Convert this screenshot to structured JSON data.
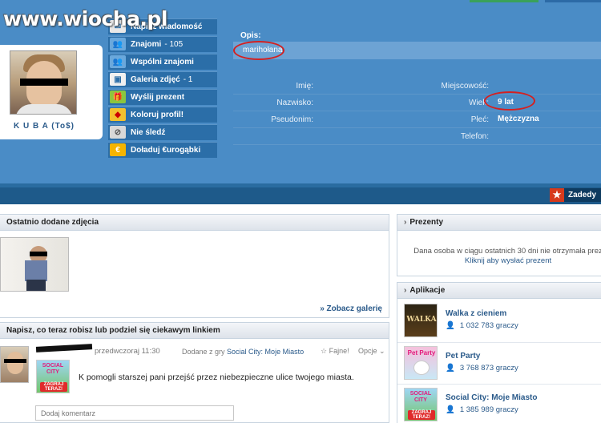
{
  "watermark": "www.wiocha.pl",
  "profile": {
    "name": "K U B A (To$)"
  },
  "menu": [
    {
      "label": "Napisz wiadomość",
      "count": "",
      "icon": "envelope-icon",
      "color": "#e8e8e8"
    },
    {
      "label": "Znajomi",
      "count": "- 105",
      "icon": "friends-icon",
      "color": "#6aa8dc"
    },
    {
      "label": "Wspólni znajomi",
      "count": "",
      "icon": "mutual-friends-icon",
      "color": "#6aa8dc"
    },
    {
      "label": "Galeria zdjęć",
      "count": "- 1",
      "icon": "gallery-icon",
      "color": "#f0f0f0"
    },
    {
      "label": "Wyślij prezent",
      "count": "",
      "icon": "gift-icon",
      "color": "#8bc53f"
    },
    {
      "label": "Koloruj profil!",
      "count": "",
      "icon": "palette-icon",
      "color": "#f2c12e"
    },
    {
      "label": "Nie śledź",
      "count": "",
      "icon": "unfollow-icon",
      "color": "#d8d8d8"
    },
    {
      "label": "Doładuj €urogąbki",
      "count": "",
      "icon": "euro-icon",
      "color": "#f5b400"
    }
  ],
  "info": {
    "opis_label": "Opis:",
    "opis_value": "marihołana",
    "rows": [
      {
        "left_label": "Imię:",
        "right_label": "Miejscowość:",
        "right_value": ""
      },
      {
        "left_label": "Nazwisko:",
        "right_label": "Wiek:",
        "right_value": "9 lat"
      },
      {
        "left_label": "Pseudonim:",
        "right_label": "Płeć:",
        "right_value": "Mężczyzna"
      },
      {
        "left_label": "",
        "right_label": "Telefon:",
        "right_value": ""
      }
    ]
  },
  "zadedy": "Zadedy",
  "photos": {
    "title": "Ostatnio dodane zdjęcia",
    "see_gallery": "» Zobacz galerię"
  },
  "status": {
    "title": "Napisz, co teraz robisz lub podziel się ciekawym linkiem",
    "time": "przedwczoraj 11:30",
    "game_prefix": "Dodane z gry",
    "game_name": "Social City: Moje Miasto",
    "like": "Fajne!",
    "options": "Opcje",
    "game_img_title": "SOCIAL CITY",
    "game_img_btn": "ZAGRAJ TERAZ!",
    "text": "K pomogli starszej pani przejść przez niebezpieczne ulice twojego miasta.",
    "comment_placeholder": "Dodaj komentarz"
  },
  "gifts": {
    "title": "Prezenty",
    "text": "Dana osoba w ciągu ostatnich 30 dni nie otrzymała prez",
    "link": "Kliknij aby wysłać prezent"
  },
  "apps": {
    "title": "Aplikacje",
    "items": [
      {
        "name": "Walka z cieniem",
        "users": "1 032 783 graczy",
        "logo_text": "WALKA"
      },
      {
        "name": "Pet Party",
        "users": "3 768 873 graczy",
        "logo_text": "Pet Party"
      },
      {
        "name": "Social City: Moje Miasto",
        "users": "1 385 989 graczy",
        "logo_text": "SOCIAL CITY",
        "logo_btn": "ZAGRAJ TERAZ!"
      }
    ]
  }
}
